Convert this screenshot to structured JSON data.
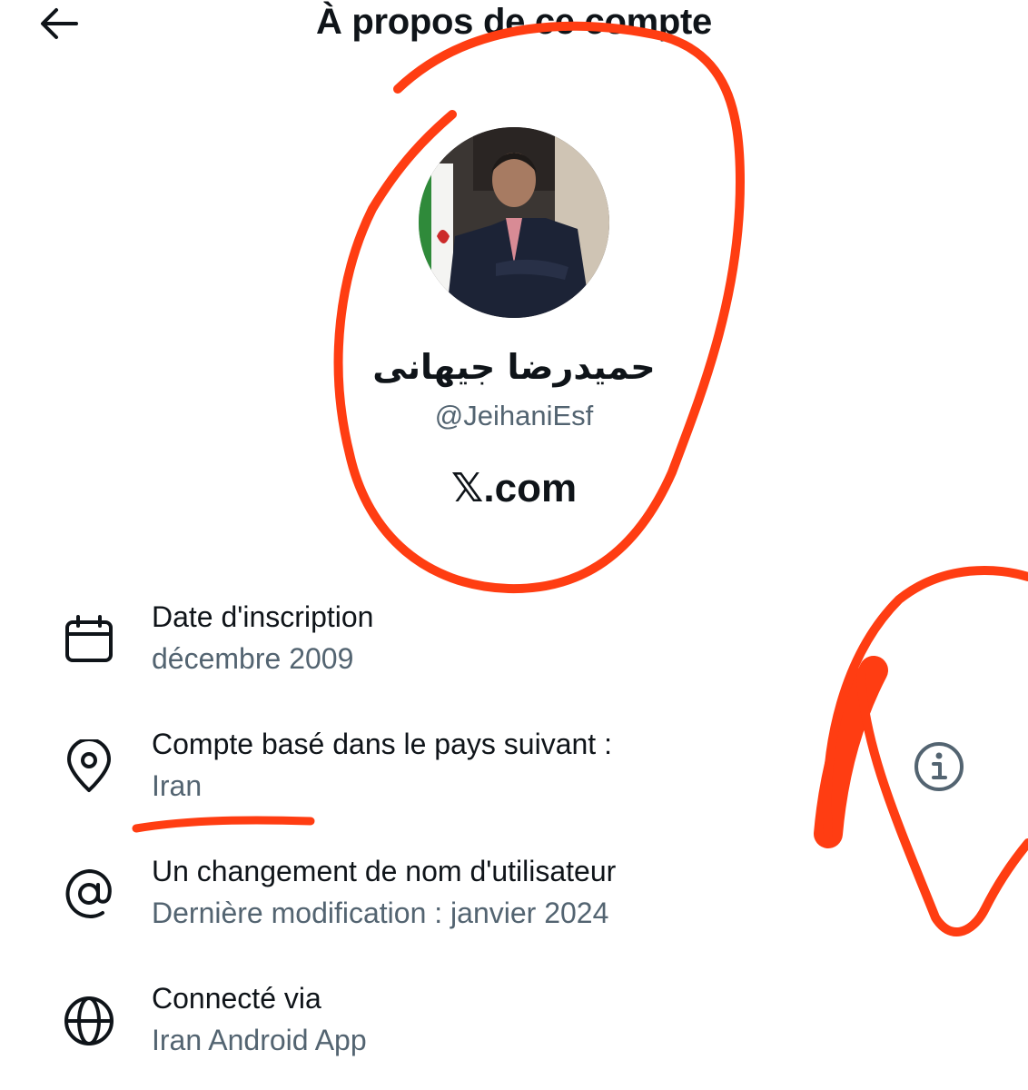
{
  "header": {
    "title": "À propos de ce compte",
    "back_icon": "arrow-left-icon"
  },
  "profile": {
    "display_name": "حمیدرضا جیهانی",
    "handle": "@JeihaniEsf",
    "site": "𝕏.com"
  },
  "rows": [
    {
      "icon": "calendar-icon",
      "title": "Date d'inscription",
      "value": "décembre 2009"
    },
    {
      "icon": "location-pin-icon",
      "title": "Compte basé dans le pays suivant :",
      "value": "Iran"
    },
    {
      "icon": "at-sign-icon",
      "title": "Un changement de nom d'utilisateur",
      "value": "Dernière modification : janvier 2024"
    },
    {
      "icon": "globe-icon",
      "title": "Connecté via",
      "value": "Iran Android App"
    }
  ],
  "colors": {
    "primary_text": "#0f1419",
    "secondary_text": "#536471",
    "annotation": "#ff3d12"
  }
}
